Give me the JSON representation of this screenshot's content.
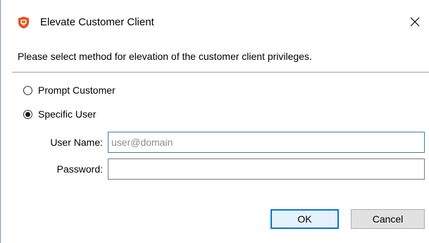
{
  "window": {
    "title": "Elevate Customer Client",
    "icon": "shield-app-icon",
    "close_icon": "close-icon"
  },
  "instruction": "Please select method for elevation of the customer client privileges.",
  "options": [
    {
      "label": "Prompt Customer",
      "selected": false
    },
    {
      "label": "Specific User",
      "selected": true
    }
  ],
  "fields": {
    "user_name": {
      "label": "User Name:",
      "value": "",
      "placeholder": "user@domain"
    },
    "password": {
      "label": "Password:",
      "value": ""
    }
  },
  "buttons": {
    "ok": "OK",
    "cancel": "Cancel"
  },
  "colors": {
    "accent": "#0078d7",
    "icon_orange": "#e8501e",
    "focus_border": "#3c7fb1"
  }
}
